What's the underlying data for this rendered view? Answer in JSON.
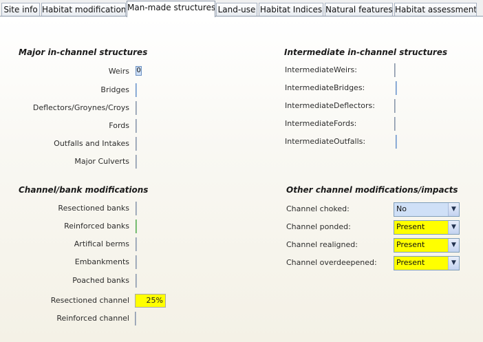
{
  "tabs": [
    {
      "label": "Site info"
    },
    {
      "label": "Habitat modification"
    },
    {
      "label": "Man-made structures"
    },
    {
      "label": "Land-use"
    },
    {
      "label": "Habitat Indices"
    },
    {
      "label": "Natural features"
    },
    {
      "label": "Habitat assessment"
    }
  ],
  "active_tab": "Man-made structures",
  "major": {
    "heading": "Major in-channel structures",
    "weirs_label": "Weirs",
    "weirs_value": "0",
    "bridges_label": "Bridges",
    "deflectors_label": "Deflectors/Groynes/Croys",
    "fords_label": "Fords",
    "outfalls_label": "Outfalls and Intakes",
    "culverts_label": "Major Culverts"
  },
  "intermediate": {
    "heading": "Intermediate in-channel structures",
    "weirs_label": "IntermediateWeirs:",
    "bridges_label": "IntermediateBridges:",
    "deflectors_label": "IntermediateDeflectors:",
    "fords_label": "IntermediateFords:",
    "outfalls_label": "IntermediateOutfalls:"
  },
  "bank": {
    "heading": "Channel/bank modifications",
    "resectioned_banks_label": "Resectioned banks",
    "reinforced_banks_label": "Reinforced banks",
    "artificial_berms_label": "Artifical berms",
    "embankments_label": "Embankments",
    "poached_banks_label": "Poached banks",
    "resectioned_channel_label": "Resectioned channel",
    "resectioned_channel_value": "25%",
    "reinforced_channel_label": "Reinforced channel"
  },
  "other": {
    "heading": "Other channel modifications/impacts",
    "choked_label": "Channel choked:",
    "choked_value": "No",
    "ponded_label": "Channel ponded:",
    "ponded_value": "Present",
    "realigned_label": "Channel realigned:",
    "realigned_value": "Present",
    "overdeepened_label": "Channel overdeepened:",
    "overdeepened_value": "Present"
  },
  "colors": {
    "highlight_yellow": "#ffff00",
    "combo_blue": "#cfe0f7",
    "tab_border": "#8c98aa"
  },
  "icons": {
    "dropdown": "chevron-down-icon"
  }
}
